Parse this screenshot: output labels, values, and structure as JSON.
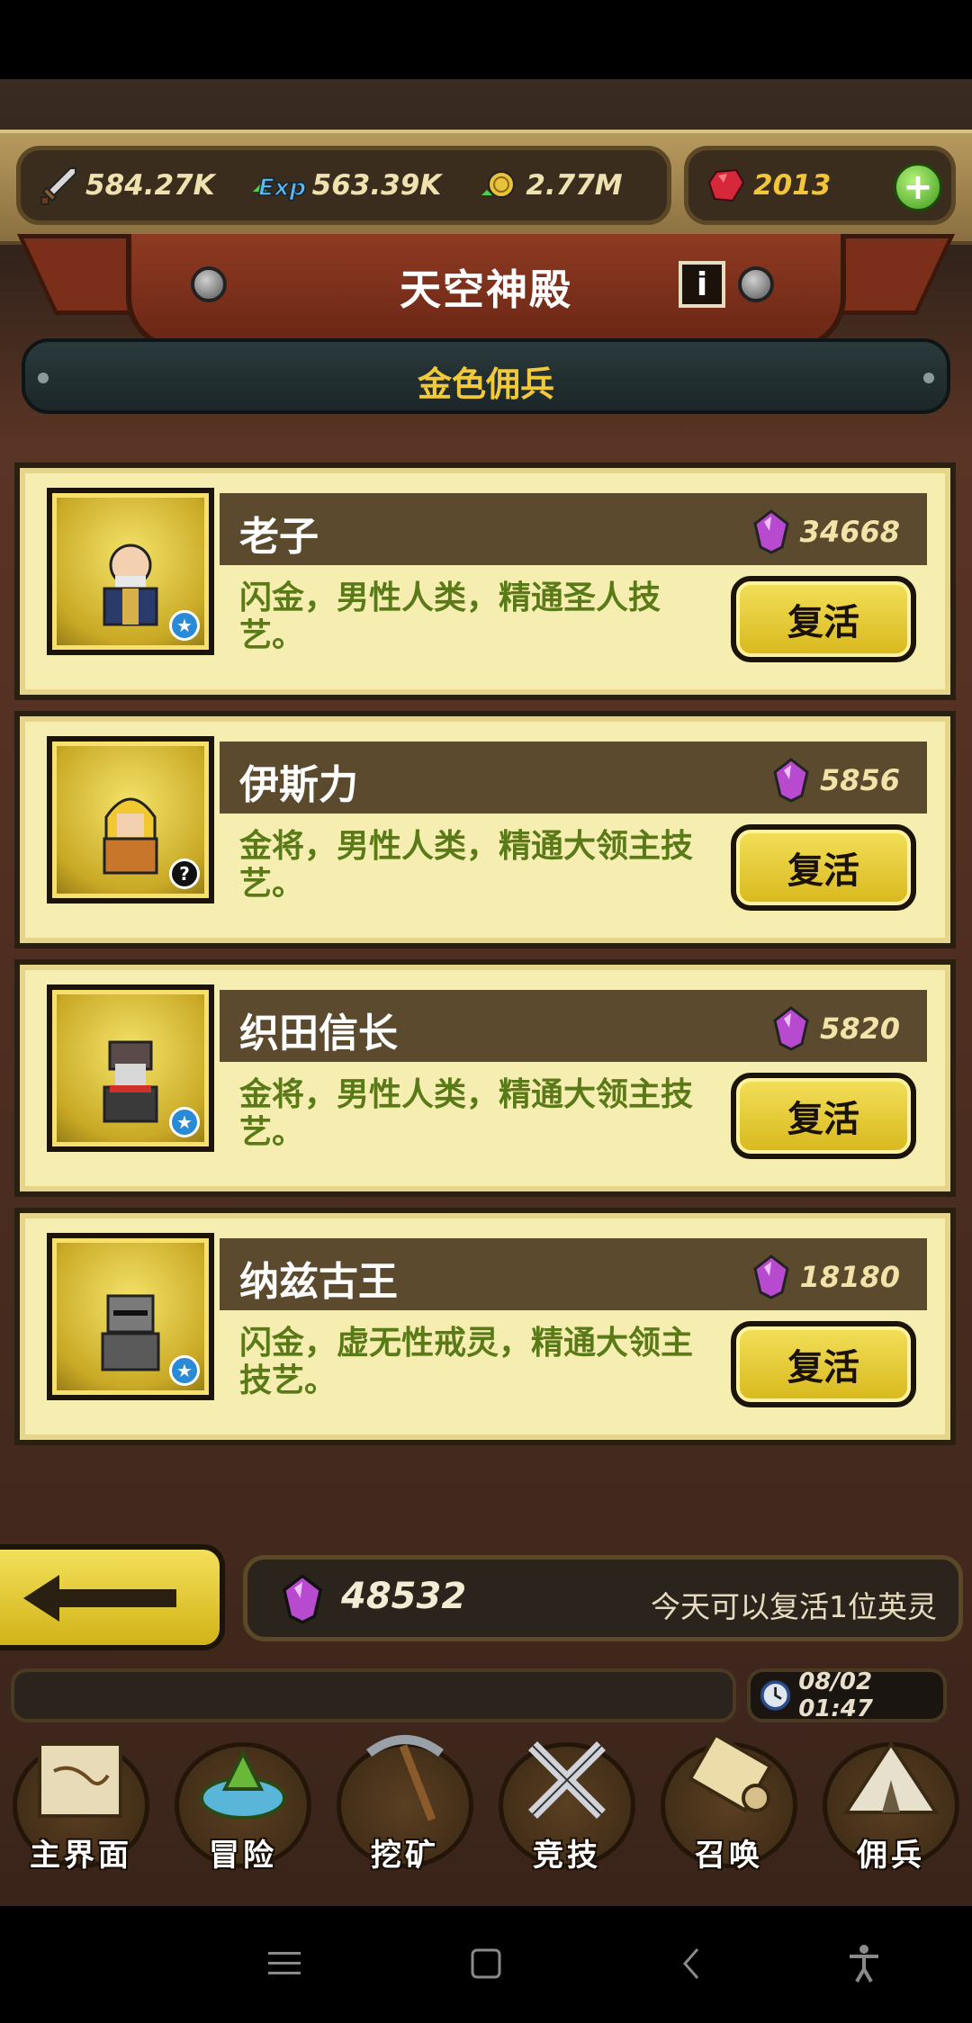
{
  "resources": {
    "attack": "584.27K",
    "exp": "563.39K",
    "gold": "2.77M",
    "gems": "2013"
  },
  "title": "天空神殿",
  "info_label": "i",
  "category": "金色佣兵",
  "heroes": [
    {
      "name": "老子",
      "cost": "34668",
      "desc": "闪金，男性人类，精通圣人技艺。",
      "badge": "★",
      "button": "复活"
    },
    {
      "name": "伊斯力",
      "cost": "5856",
      "desc": "金将，男性人类，精通大领主技艺。",
      "badge": "?",
      "button": "复活"
    },
    {
      "name": "织田信长",
      "cost": "5820",
      "desc": "金将，男性人类，精通大领主技艺。",
      "badge": "★",
      "button": "复活"
    },
    {
      "name": "纳兹古王",
      "cost": "18180",
      "desc": "闪金，虚无性戒灵，精通大领主技艺。",
      "badge": "★",
      "button": "复活"
    }
  ],
  "gem_total": "48532",
  "revive_note": "今天可以复活1位英灵",
  "time": "08/02 01:47",
  "nav": [
    {
      "label": "主界面",
      "icon": "map-scroll-icon"
    },
    {
      "label": "冒险",
      "icon": "island-icon"
    },
    {
      "label": "挖矿",
      "icon": "pickaxe-icon"
    },
    {
      "label": "竞技",
      "icon": "crossed-swords-icon"
    },
    {
      "label": "召唤",
      "icon": "summon-scroll-icon"
    },
    {
      "label": "佣兵",
      "icon": "tent-icon"
    }
  ],
  "colors": {
    "accent": "#f2c93a",
    "card": "#f6eeb0",
    "desc_text": "#5a7a18",
    "banner": "#8e3a22"
  }
}
